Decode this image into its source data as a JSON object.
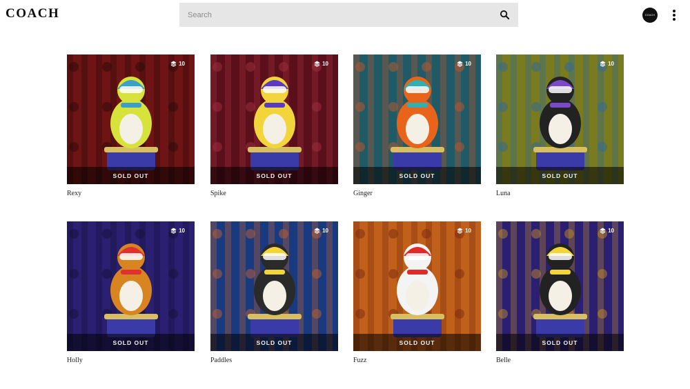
{
  "header": {
    "logo": "COACH",
    "search_placeholder": "Search",
    "account_label": "COACH"
  },
  "edition_icon": "stack-layers-icon",
  "items": [
    {
      "name": "Rexy",
      "edition": "10",
      "status": "SOLD OUT",
      "curtain": "#6e1414",
      "pattern": "#2a0808",
      "body": "#d7e23a",
      "accent": "#3aa0c8"
    },
    {
      "name": "Spike",
      "edition": "10",
      "status": "SOLD OUT",
      "curtain": "#5a0f1a",
      "pattern": "#a0303e",
      "body": "#f2d53a",
      "accent": "#5a3bc0"
    },
    {
      "name": "Ginger",
      "edition": "10",
      "status": "SOLD OUT",
      "curtain": "#1f5a66",
      "pattern": "#c0572a",
      "body": "#e8641a",
      "accent": "#30b0b0"
    },
    {
      "name": "Luna",
      "edition": "10",
      "status": "SOLD OUT",
      "curtain": "#7a7a1e",
      "pattern": "#2a6aa0",
      "body": "#222222",
      "accent": "#7a4ac8"
    },
    {
      "name": "Holly",
      "edition": "10",
      "status": "SOLD OUT",
      "curtain": "#2a1f70",
      "pattern": "#15103a",
      "body": "#d88420",
      "accent": "#e03030"
    },
    {
      "name": "Paddles",
      "edition": "10",
      "status": "SOLD OUT",
      "curtain": "#1a3a80",
      "pattern": "#c06030",
      "body": "#2a2a2a",
      "accent": "#f2d53a"
    },
    {
      "name": "Fuzz",
      "edition": "10",
      "status": "SOLD OUT",
      "curtain": "#c0601a",
      "pattern": "#7a2a10",
      "body": "#f4f4f4",
      "accent": "#e02a2a"
    },
    {
      "name": "Belle",
      "edition": "10",
      "status": "SOLD OUT",
      "curtain": "#2a1f70",
      "pattern": "#c08a2a",
      "body": "#222222",
      "accent": "#f2d53a"
    }
  ]
}
